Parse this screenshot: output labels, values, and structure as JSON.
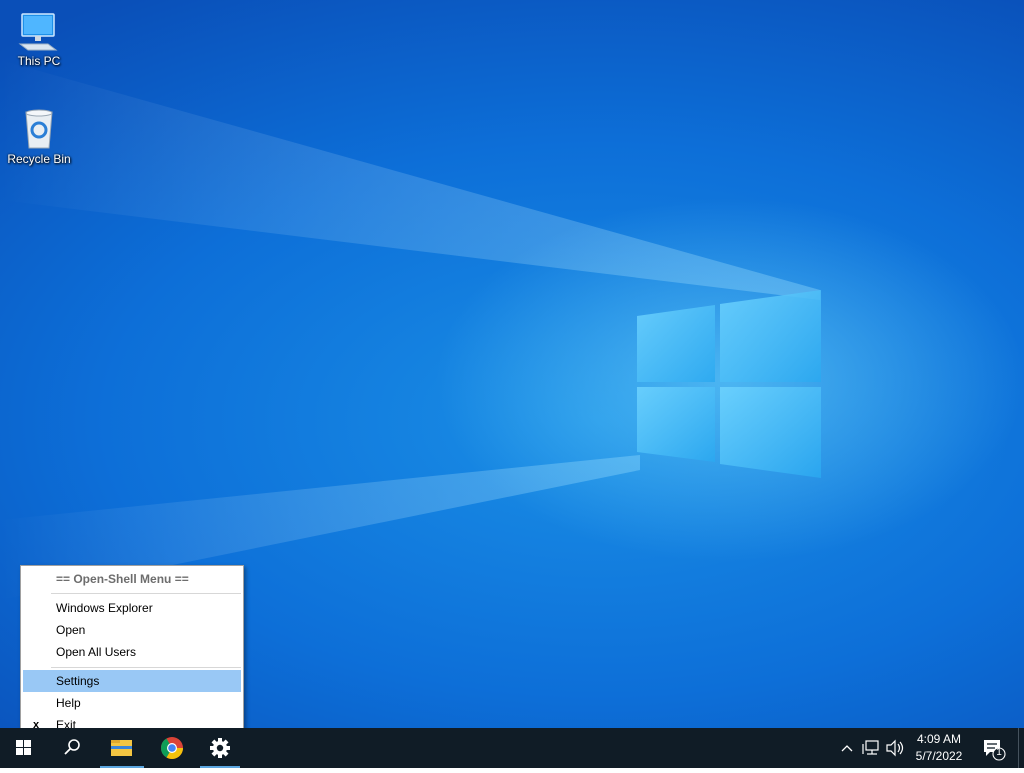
{
  "desktop": {
    "icons": [
      {
        "label": "This PC",
        "icon": "computer-icon"
      },
      {
        "label": "Recycle Bin",
        "icon": "recycle-bin-icon"
      }
    ]
  },
  "context_menu": {
    "header": "== Open-Shell Menu ==",
    "items": [
      {
        "label": "Windows Explorer"
      },
      {
        "label": "Open"
      },
      {
        "label": "Open All Users"
      },
      {
        "label": "Settings",
        "highlighted": true
      },
      {
        "label": "Help"
      },
      {
        "label": "Exit",
        "mark": "x"
      }
    ]
  },
  "taskbar": {
    "buttons": [
      {
        "name": "start",
        "icon": "windows-logo-icon"
      },
      {
        "name": "search",
        "icon": "search-icon"
      },
      {
        "name": "file-explorer",
        "icon": "folder-icon",
        "active": true
      },
      {
        "name": "chrome",
        "icon": "chrome-icon"
      },
      {
        "name": "settings",
        "icon": "gear-icon",
        "active": true
      }
    ],
    "tray": {
      "time": "4:09 AM",
      "date": "5/7/2022",
      "notification_count": "1"
    }
  },
  "colors": {
    "taskbar_bg": "#101c26",
    "menu_highlight": "#99c8f5",
    "active_underline": "#5ba6e0"
  }
}
